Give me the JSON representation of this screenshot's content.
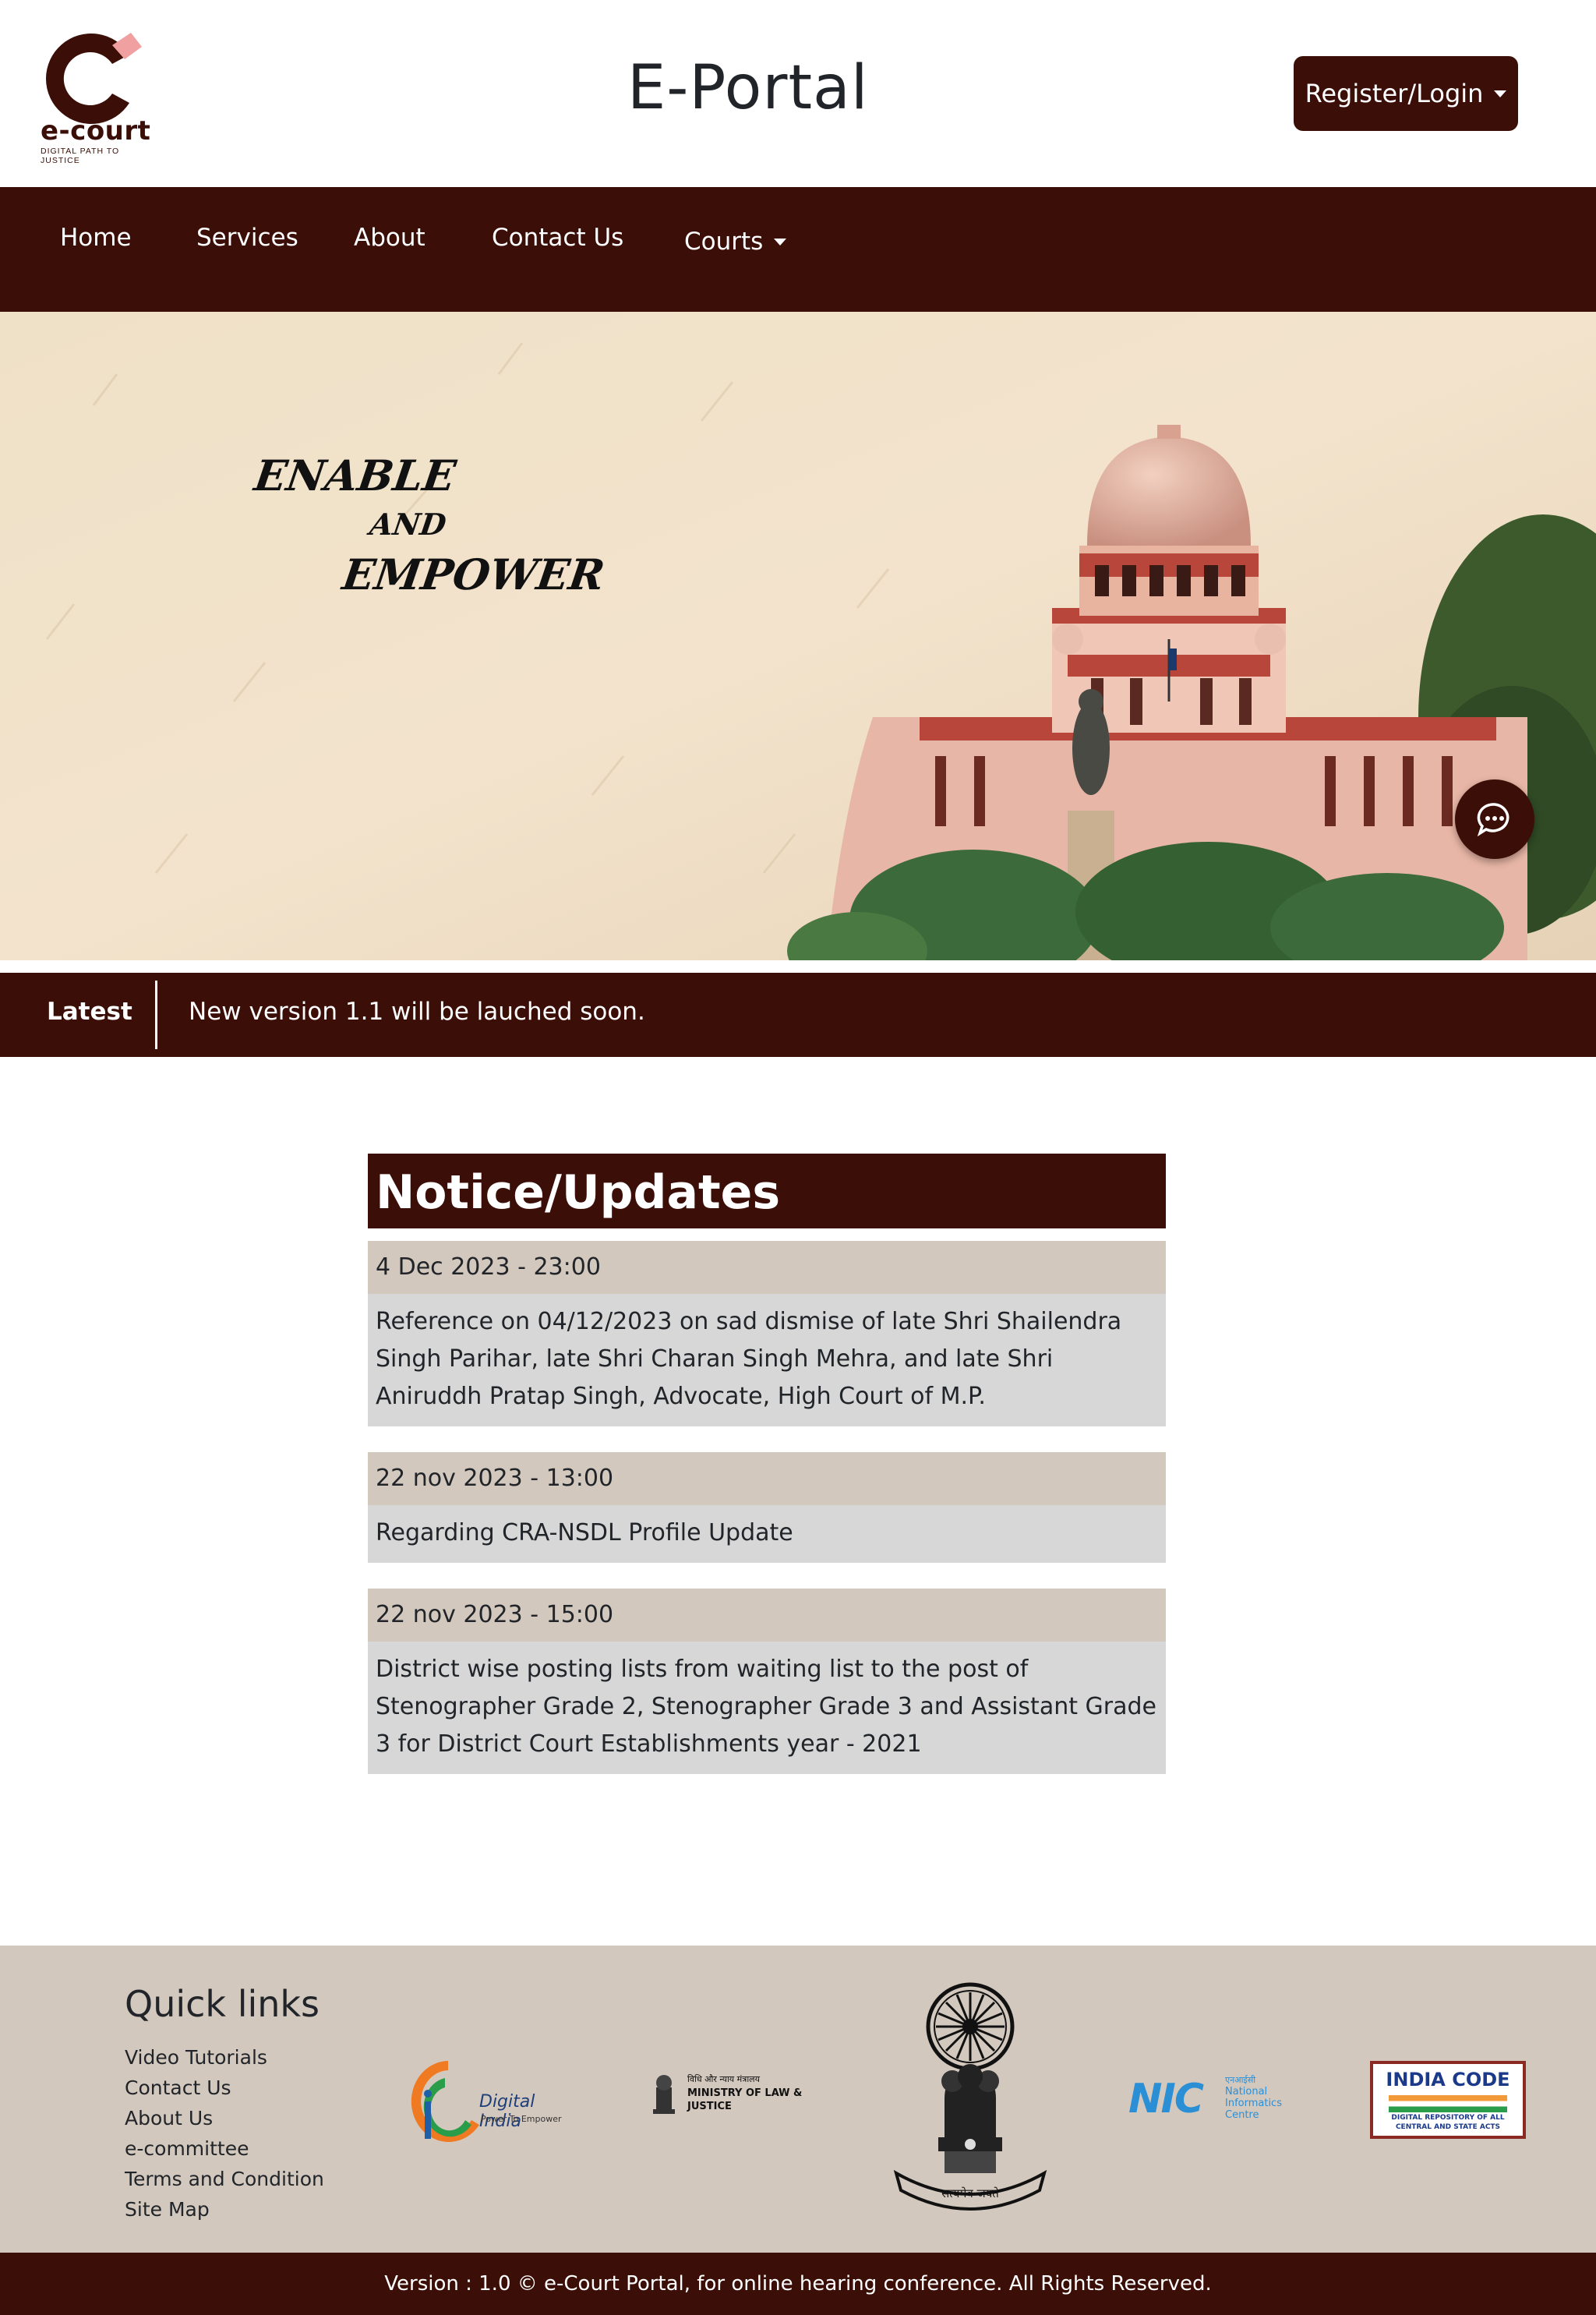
{
  "header": {
    "logo_text": "e-court",
    "logo_tagline": "DIGITAL PATH TO JUSTICE",
    "title": "E-Portal",
    "register_label": "Register/Login"
  },
  "nav": {
    "items": [
      "Home",
      "Services",
      "About",
      "Contact Us"
    ],
    "courts_label": "Courts"
  },
  "banner": {
    "line1": "ENABLE",
    "line2": "AND",
    "line3": "EMPOWER"
  },
  "latest": {
    "label": "Latest",
    "text": "New version 1.1 will be lauched soon."
  },
  "notices": {
    "title": "Notice/Updates",
    "items": [
      {
        "date": "4 Dec 2023 - 23:00",
        "text": "Reference on 04/12/2023 on sad dismise of late Shri Shailendra Singh Parihar, late Shri Charan Singh Mehra, and late Shri Aniruddh Pratap Singh, Advocate, High Court of M.P."
      },
      {
        "date": "22 nov 2023 - 13:00",
        "text": "Regarding CRA-NSDL Profile Update"
      },
      {
        "date": "22 nov 2023 - 15:00",
        "text": "District wise posting lists from waiting list to the post of Stenographer Grade 2, Stenographer Grade 3 and Assistant Grade 3 for District Court Establishments year - 2021"
      }
    ]
  },
  "footer": {
    "quick_links_title": "Quick links",
    "quick_links": [
      "Video Tutorials",
      "Contact Us",
      "About Us",
      "e-committee",
      "Terms and Condition",
      "Site Map"
    ],
    "logos": {
      "digital_india": {
        "name": "Digital India",
        "tagline": "Power To Empower"
      },
      "ministry": {
        "hindi": "विधि और न्याय मंत्रालय",
        "name_line1": "MINISTRY OF LAW &",
        "name_line2": "JUSTICE"
      },
      "emblem_motto": "सत्यमेव जयते",
      "nic": {
        "short": "NIC",
        "hindi": "एनआईसी",
        "line1": "National",
        "line2": "Informatics",
        "line3": "Centre"
      },
      "india_code": {
        "title": "INDIA CODE",
        "subtitle_line1": "DIGITAL REPOSITORY OF ALL",
        "subtitle_line2": "CENTRAL AND STATE ACTS"
      }
    },
    "copyright": "Version : 1.0 © e-Court Portal, for online hearing conference. All Rights Reserved."
  },
  "colors": {
    "brand": "#3b0e07",
    "notice_date_bg": "#d3c8be",
    "notice_body_bg": "#d7d7d7",
    "footer_bg": "#d3c8be"
  }
}
